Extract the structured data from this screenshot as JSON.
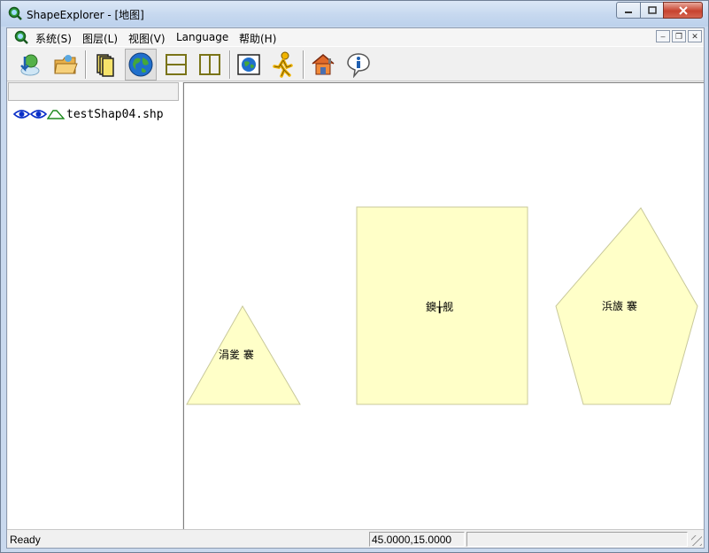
{
  "window": {
    "title": "ShapeExplorer - [地图]",
    "app_icon": "globe-magnifier-icon",
    "controls": {
      "minimize_icon": "minimize-icon",
      "maximize_icon": "maximize-icon",
      "close_icon": "close-icon"
    }
  },
  "menu": {
    "items": [
      "系统(S)",
      "图层(L)",
      "视图(V)",
      "Language",
      "帮助(H)"
    ],
    "mdi_controls": [
      "minimize-icon",
      "restore-icon",
      "close-icon"
    ]
  },
  "toolbar": {
    "buttons": [
      {
        "icon": "download-globe-icon",
        "pressed": false
      },
      {
        "icon": "open-folder-icon",
        "pressed": false
      },
      {
        "icon": "layers-stack-icon",
        "pressed": false
      },
      {
        "icon": "globe-icon",
        "pressed": true
      },
      {
        "icon": "split-horizontal-icon",
        "pressed": false
      },
      {
        "icon": "split-vertical-icon",
        "pressed": false
      },
      {
        "icon": "map-image-icon",
        "pressed": false
      },
      {
        "icon": "running-man-icon",
        "pressed": false
      },
      {
        "icon": "house-tools-icon",
        "pressed": false
      },
      {
        "icon": "info-icon",
        "pressed": false
      }
    ]
  },
  "layers": {
    "items": [
      {
        "name": "testShap04.shp",
        "icons": [
          "visible-eye-icon",
          "selectable-eye-icon",
          "polygon-layer-icon"
        ]
      }
    ]
  },
  "map": {
    "fill_color": "#ffffc8",
    "stroke_color": "#c8c89a",
    "shapes": [
      {
        "type": "triangle",
        "label": "涓夎  褰"
      },
      {
        "type": "rectangle",
        "label": "鐭╁舰"
      },
      {
        "type": "pentagon",
        "label": "浜旇  褰"
      }
    ]
  },
  "status": {
    "text": "Ready",
    "coordinates": "45.0000,15.0000",
    "extra": ""
  }
}
